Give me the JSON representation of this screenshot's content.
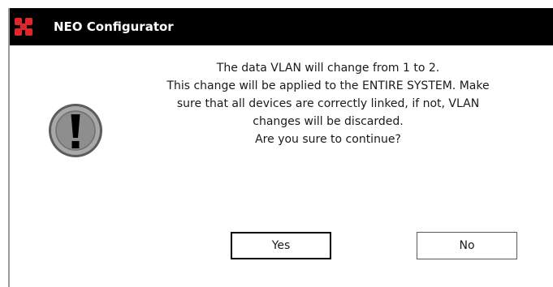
{
  "window": {
    "title": "NEO Configurator",
    "logo_icon": "red-cross-logo-icon",
    "icon": "exclamation-warning-icon"
  },
  "message": {
    "lines": [
      "The data VLAN will change from 1 to 2.",
      "This change will be applied to the ENTIRE SYSTEM. Make",
      "sure that all devices are correctly linked, if not, VLAN",
      "changes will be discarded.",
      "Are you sure to continue?"
    ]
  },
  "buttons": {
    "yes_label": "Yes",
    "no_label": "No"
  },
  "colors": {
    "titlebar": "#000000",
    "logo": "#e0262b",
    "icon_ring": "#8a8a8a"
  }
}
